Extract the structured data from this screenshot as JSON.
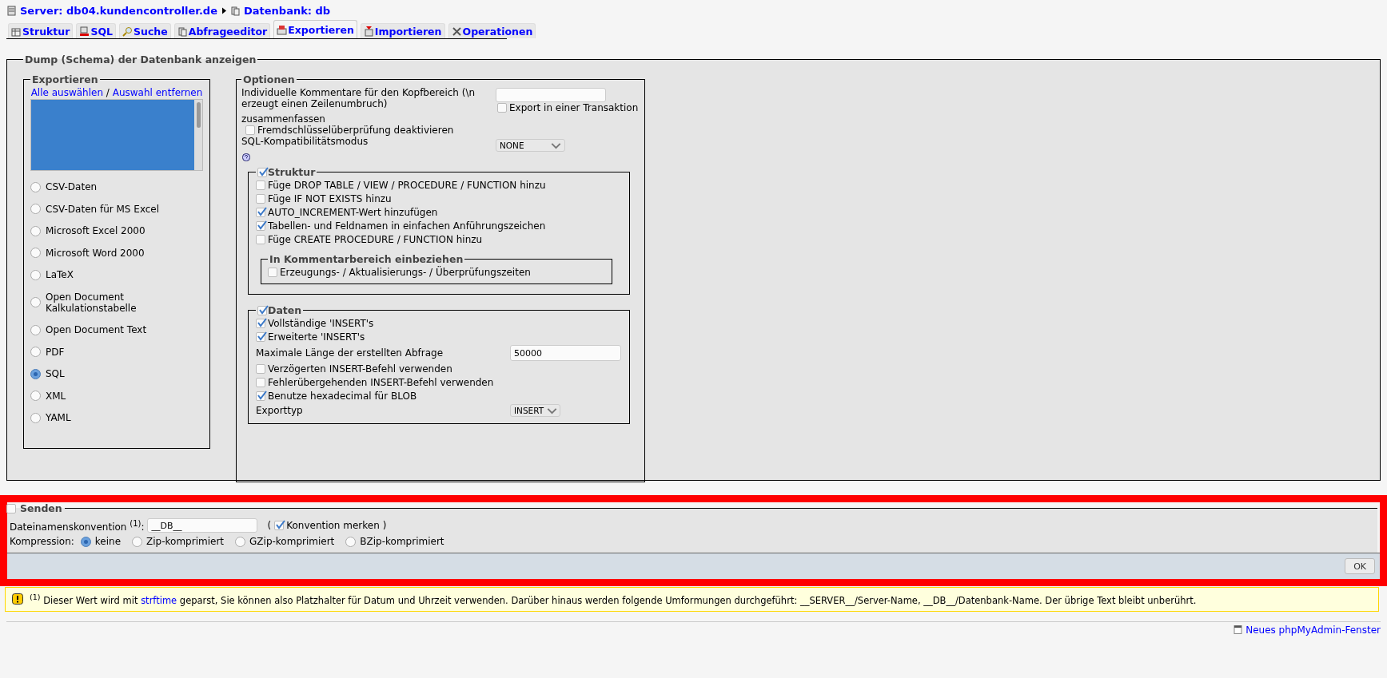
{
  "breadcrumb": [
    {
      "label": "Server: db04.kundencontroller.de"
    },
    {
      "label": "Datenbank: db"
    }
  ],
  "tabs": [
    {
      "label": "Struktur",
      "selected": false
    },
    {
      "label": "SQL",
      "selected": false
    },
    {
      "label": "Suche",
      "selected": false
    },
    {
      "label": "Abfrageeditor",
      "selected": false
    },
    {
      "label": "Exportieren",
      "selected": true
    },
    {
      "label": "Importieren",
      "selected": false
    },
    {
      "label": "Operationen",
      "selected": false
    }
  ],
  "dump": {
    "legend": "Dump (Schema) der Datenbank anzeigen",
    "export": {
      "legend": "Exportieren",
      "select_all": "Alle auswählen",
      "separator": "/",
      "deselect_all": "Auswahl entfernen",
      "formats": [
        {
          "label": "CSV-Daten",
          "selected": false
        },
        {
          "label": "CSV-Daten für MS Excel",
          "selected": false
        },
        {
          "label": "Microsoft Excel 2000",
          "selected": false
        },
        {
          "label": "Microsoft Word 2000",
          "selected": false
        },
        {
          "label": "LaTeX",
          "selected": false
        },
        {
          "label": "Open Document Kalkulationstabelle",
          "selected": false
        },
        {
          "label": "Open Document Text",
          "selected": false
        },
        {
          "label": "PDF",
          "selected": false
        },
        {
          "label": "SQL",
          "selected": true
        },
        {
          "label": "XML",
          "selected": false
        },
        {
          "label": "YAML",
          "selected": false
        }
      ]
    },
    "options": {
      "legend": "Optionen",
      "header_comment_label": "Individuelle Kommentare für den Kopfbereich (\\n erzeugt einen Zeilenumbruch)",
      "transaction": {
        "label": "Export in einer Transaktion",
        "checked": false
      },
      "transaction_cont": "zusammenfassen",
      "foreign_keys": {
        "label": "Fremdschlüsselüberprüfung deaktivieren",
        "checked": false
      },
      "compat_label": "SQL-Kompatibilitätsmodus",
      "compat_value": "NONE",
      "structure": {
        "legend": "Struktur",
        "checked": true,
        "items": [
          {
            "label": "Füge DROP TABLE / VIEW / PROCEDURE / FUNCTION hinzu",
            "checked": false
          },
          {
            "label": "Füge IF NOT EXISTS hinzu",
            "checked": false
          },
          {
            "label": "AUTO_INCREMENT-Wert hinzufügen",
            "checked": true
          },
          {
            "label": "Tabellen- und Feldnamen in einfachen Anführungszeichen",
            "checked": true
          },
          {
            "label": "Füge CREATE PROCEDURE / FUNCTION hinzu",
            "checked": false
          }
        ],
        "comments": {
          "legend": "In Kommentarbereich einbeziehen",
          "items": [
            {
              "label": "Erzeugungs- / Aktualisierungs- / Überprüfungszeiten",
              "checked": false
            }
          ]
        }
      },
      "data": {
        "legend": "Daten",
        "checked": true,
        "rows": [
          {
            "kind": "checkbox",
            "label": "Vollständige 'INSERT's",
            "checked": true
          },
          {
            "kind": "checkbox",
            "label": "Erweiterte 'INSERT's",
            "checked": true
          },
          {
            "kind": "text",
            "label": "Maximale Länge der erstellten Abfrage",
            "value": "50000"
          },
          {
            "kind": "checkbox",
            "label": "Verzögerten INSERT-Befehl verwenden",
            "checked": false
          },
          {
            "kind": "checkbox",
            "label": "Fehlerübergehenden INSERT-Befehl verwenden",
            "checked": false
          },
          {
            "kind": "checkbox",
            "label": "Benutze hexadecimal für BLOB",
            "checked": true
          },
          {
            "kind": "select",
            "label": "Exporttyp",
            "value": "INSERT"
          }
        ]
      }
    }
  },
  "send": {
    "label": "Senden",
    "checked": false,
    "filename_label": "Dateinamenskonvention $^{(1)}$:",
    "filename_value": "__DB__",
    "open_paren": "(",
    "remember": {
      "label": "Konvention merken",
      "checked": true
    },
    "close_paren": ")",
    "compression_label": "Kompression:",
    "compression": [
      {
        "label": "keine",
        "selected": true
      },
      {
        "label": "Zip-komprimiert",
        "selected": false
      },
      {
        "label": "GZip-komprimiert",
        "selected": false
      },
      {
        "label": "BZip-komprimiert",
        "selected": false
      }
    ]
  },
  "ok_button": "OK",
  "notice": {
    "mark": "$^{(1)}$",
    "before": " Dieser Wert wird mit ",
    "link": "strftime",
    "after": " geparst, Sie können also Platzhalter für Datum und Uhrzeit verwenden. Darüber hinaus werden folgende Umformungen durchgeführt: __SERVER__/Server-Name, __DB__/Datenbank-Name. Der übrige Text bleibt unberührt."
  },
  "new_window_link": "Neues phpMyAdmin-Fenster"
}
